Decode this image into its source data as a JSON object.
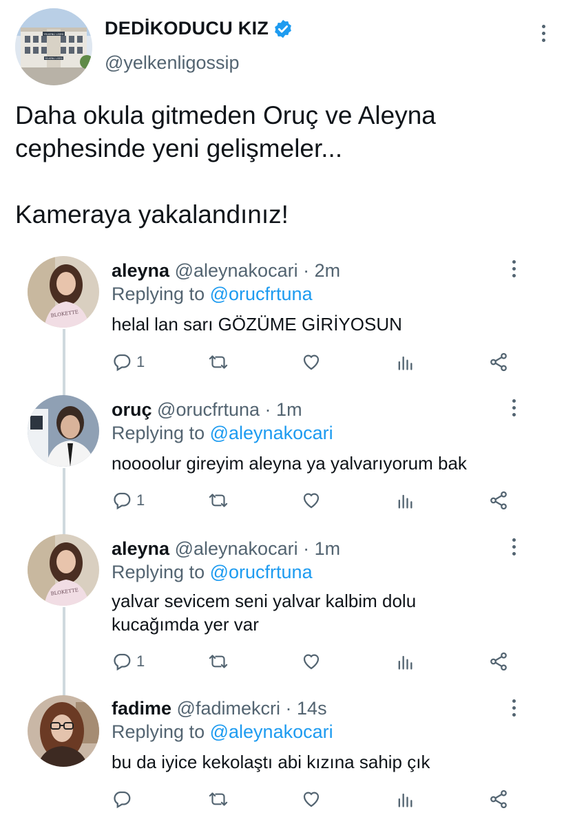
{
  "main_tweet": {
    "name": "DEDİKODUCU KIZ",
    "handle": "@yelkenligossip",
    "verified": true,
    "lines": [
      "Daha okula gitmeden Oruç ve Aleyna",
      "cephesinde yeni gelişmeler..."
    ],
    "line2": "Kameraya yakalandınız!",
    "avatar_sign_top": "YELKENLİ LİSESİ",
    "avatar_sign_bottom": "YELKENLİ LİSESİ"
  },
  "replies": [
    {
      "name": "aleyna",
      "handle": "@aleynakocari",
      "sep": "·",
      "time": "2m",
      "replying_prefix": "Replying to",
      "replying_to": "@orucfrtuna",
      "text": "helal lan sarı GÖZÜME GİRİYOSUN",
      "reply_count": "1",
      "shirt_text": "BLOKETTE"
    },
    {
      "name": "oruç",
      "handle": "@orucfrtuna",
      "sep": "·",
      "time": "1m",
      "replying_prefix": "Replying to",
      "replying_to": "@aleynakocari",
      "text": "noooolur gireyim aleyna ya yalvarıyorum bak",
      "reply_count": "1"
    },
    {
      "name": "aleyna",
      "handle": "@aleynakocari",
      "sep": "·",
      "time": "1m",
      "replying_prefix": "Replying to",
      "replying_to": "@orucfrtuna",
      "text": "yalvar sevicem seni yalvar kalbim dolu kucağımda yer var",
      "reply_count": "1",
      "shirt_text": "BLOKETTE"
    },
    {
      "name": "fadime",
      "handle": "@fadimekcri",
      "sep": "·",
      "time": "14s",
      "replying_prefix": "Replying to",
      "replying_to": "@aleynakocari",
      "text": "bu da iyice kekolaştı abi kızına sahip çık",
      "reply_count": ""
    }
  ],
  "icons": {
    "reply": "reply-icon",
    "retweet": "retweet-icon",
    "like": "heart-icon",
    "views": "analytics-icon",
    "share": "share-icon",
    "more": "more-icon",
    "verified": "verified-badge-icon"
  },
  "colors": {
    "link": "#1d9bf0",
    "muted": "#536471",
    "text": "#0f1419",
    "thread": "#cfd9de"
  }
}
